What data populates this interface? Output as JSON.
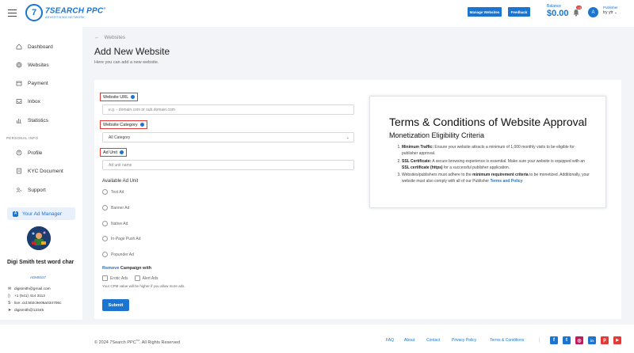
{
  "topbar": {
    "logo_title": "7SEARCH PPC",
    "logo_reg": "®",
    "logo_sub": "ADVERTISING NETWORK",
    "manage_websites": "Manage Websites",
    "feedback": "Feedback",
    "balance_label": "Balance",
    "balance_value": "$0.00",
    "notification_count": "15",
    "avatar_initial": "A",
    "user_role": "Publisher",
    "user_name": "try ytr"
  },
  "sidebar": {
    "items": [
      {
        "label": "Dashboard",
        "icon": "home-icon"
      },
      {
        "label": "Websites",
        "icon": "globe-icon"
      },
      {
        "label": "Payment",
        "icon": "wallet-icon"
      },
      {
        "label": "Inbox",
        "icon": "inbox-icon"
      },
      {
        "label": "Statistics",
        "icon": "chart-icon"
      }
    ],
    "personal_info_title": "PERSONAL INFO",
    "personal_items": [
      {
        "label": "Profile",
        "icon": "profile-icon"
      },
      {
        "label": "KYC Document",
        "icon": "document-icon"
      },
      {
        "label": "Support",
        "icon": "support-icon"
      }
    ],
    "ad_manager": "Your Ad Manager",
    "manager_name": "Digi Smith test word char",
    "manager_id": "ADM5537",
    "email": "digismith@gmail.com",
    "phone": "+1 (541) 414 3112",
    "live_id": "live:.cid.502c9e05a034706c",
    "telegram": "digismith@12345"
  },
  "main": {
    "breadcrumb": "Websites",
    "title": "Add New Website",
    "subtitle": "Here you can add a new website.",
    "website_url_label": "Website URL",
    "website_url_placeholder": "e.g. - domain.com or sub.domain.com",
    "category_label": "Website Category",
    "category_value": "All Category",
    "ad_unit_label": "Ad Unit",
    "ad_unit_placeholder": "Ad unit name",
    "available_title": "Available Ad Unit",
    "ad_units": [
      "Text Ad",
      "Banner Ad",
      "Native Ad",
      "In-Page Push Ad",
      "Popunder Ad"
    ],
    "remove_word": "Remove",
    "campaign_with": " Campaign with",
    "erotic_ads": "Erotic Ads",
    "alert_ads": "Alert Ads",
    "cpm_hint": "Your CPM value will be higher if you allow more ads.",
    "submit": "Submit"
  },
  "terms": {
    "title": "Terms & Conditions of Website Approval",
    "subtitle": "Monetization Eligibility Criteria",
    "item1_bold": "Minimum Traffic:",
    "item1_text": " Ensure your website attracts a minimum of 1,000 monthly visits to be eligible for publisher approval.",
    "item2_bold": "SSL Certificate:",
    "item2_text": " A secure browsing experience is essential. Make sure your website is equipped with an ",
    "item2_bold2": "SSL certificate (https)",
    "item2_text2": " for a successful publisher application.",
    "item3_text": "Websites/publishers must adhere to the ",
    "item3_bold": "minimum requirement criteria",
    "item3_text2": " to be monetized. Additionally, your website must also comply with all of our Publisher ",
    "item3_link": "Terms and Policy"
  },
  "footer": {
    "copyright_pre": "© 2024 7Search PPC",
    "tm": "TM",
    "copyright_post": ". All Rights Reserved",
    "links": [
      "FAQ",
      "About",
      "Contact",
      "Privacy Policy",
      "Terms & Conditions"
    ],
    "divider": "|",
    "socials": [
      {
        "icon": "facebook-icon",
        "glyph": "f",
        "color": "#1b75d0"
      },
      {
        "icon": "twitter-icon",
        "glyph": "t",
        "color": "#1b75d0"
      },
      {
        "icon": "instagram-icon",
        "glyph": "◎",
        "color": "#c2185b"
      },
      {
        "icon": "linkedin-icon",
        "glyph": "in",
        "color": "#1b75d0"
      },
      {
        "icon": "pinterest-icon",
        "glyph": "p",
        "color": "#e53935"
      },
      {
        "icon": "youtube-icon",
        "glyph": "▶",
        "color": "#e53935"
      }
    ]
  },
  "colors": {
    "accent": "#1b75d0",
    "required_border": "#e53935",
    "background": "#f3f4f7"
  }
}
